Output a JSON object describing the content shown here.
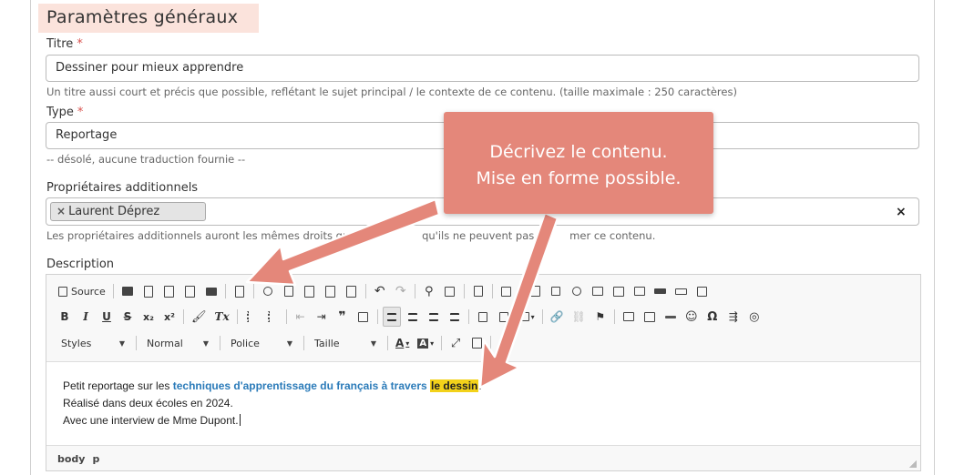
{
  "section": {
    "title": "Paramètres généraux"
  },
  "title_field": {
    "label": "Titre",
    "required_mark": "*",
    "value": "Dessiner pour mieux apprendre",
    "help": "Un titre aussi court et précis que possible, reflétant le sujet principal / le contexte de ce contenu. (taille maximale : 250 caractères)"
  },
  "type_field": {
    "label": "Type",
    "required_mark": "*",
    "value": "Reportage",
    "help": "-- désolé, aucune traduction fournie --"
  },
  "owners_field": {
    "label": "Propriétaires additionnels",
    "tag_remove": "×",
    "tag": "Laurent Déprez",
    "clear": "×",
    "help_start": "Les propriétaires additionnels auront les mêmes droits que vou",
    "help_end": "qu'ils ne peuvent pas su",
    "help_tail": "mer ce contenu."
  },
  "description": {
    "label": "Description",
    "toolbar": {
      "source_label": "Source",
      "bold": "B",
      "italic": "I",
      "underline": "U",
      "strike": "S",
      "subscript": "x₂",
      "superscript": "x²",
      "clear_format": "Tx",
      "quote": "❞",
      "styles": "Styles",
      "format": "Normal",
      "font": "Police",
      "size": "Taille",
      "text_color": "A",
      "bg_color": "A",
      "omega": "Ω"
    },
    "content": {
      "line1_prefix": "Petit reportage sur les ",
      "line1_link": "techniques d'apprentissage du français à travers",
      "line1_space": " ",
      "line1_highlight": "le dessin",
      "line1_suffix": ".",
      "line2": "Réalisé dans deux écoles en 2024.",
      "line3": "Avec une interview de Mme Dupont."
    },
    "status_path": [
      "body",
      "p"
    ]
  },
  "callout": {
    "line1": "Décrivez le contenu.",
    "line2": "Mise en forme possible.",
    "color": "#e4877a"
  }
}
